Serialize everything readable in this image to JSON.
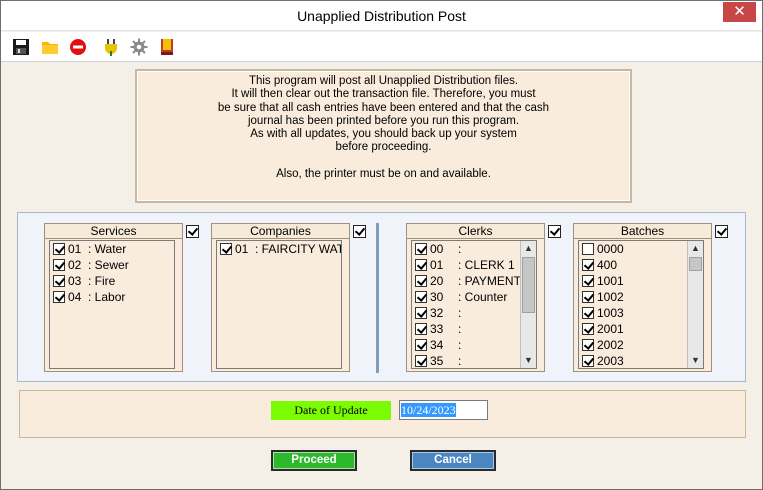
{
  "window": {
    "title": "Unapplied Distribution Post",
    "close_symbol": "✕"
  },
  "toolbar": {
    "icons": [
      "save-icon",
      "open-folder-icon",
      "stop-icon",
      "plug-icon",
      "gear-icon",
      "book-icon"
    ]
  },
  "message": {
    "lines": [
      "This program will post all Unapplied Distribution files.",
      "It will then clear out the transaction file. Therefore, you must",
      "be sure that all cash entries have been entered and that the cash",
      "journal has been printed before you run this program.",
      "As with all updates, you should back up your system",
      "before proceeding.",
      "",
      "Also, the printer must be on and available."
    ]
  },
  "services": {
    "title": "Services",
    "all_checked": true,
    "items": [
      {
        "code": "01",
        "label": "Water",
        "checked": true
      },
      {
        "code": "02",
        "label": "Sewer",
        "checked": true
      },
      {
        "code": "03",
        "label": "Fire",
        "checked": true
      },
      {
        "code": "04",
        "label": "Labor",
        "checked": true
      }
    ]
  },
  "companies": {
    "title": "Companies",
    "all_checked": true,
    "items": [
      {
        "code": "01",
        "label": "FAIRCITY WAT",
        "checked": true
      }
    ]
  },
  "clerks": {
    "title": "Clerks",
    "all_checked": true,
    "items": [
      {
        "code": "00",
        "label": "",
        "checked": true
      },
      {
        "code": "01",
        "label": "CLERK 1",
        "checked": true
      },
      {
        "code": "20",
        "label": "PAYMENT",
        "checked": true
      },
      {
        "code": "30",
        "label": "Counter",
        "checked": true
      },
      {
        "code": "32",
        "label": "",
        "checked": true
      },
      {
        "code": "33",
        "label": "",
        "checked": true
      },
      {
        "code": "34",
        "label": "",
        "checked": true
      },
      {
        "code": "35",
        "label": "",
        "checked": true
      }
    ]
  },
  "batches": {
    "title": "Batches",
    "all_checked": true,
    "items": [
      {
        "code": "0000",
        "checked": false
      },
      {
        "code": "400",
        "checked": true
      },
      {
        "code": "1001",
        "checked": true
      },
      {
        "code": "1002",
        "checked": true
      },
      {
        "code": "1003",
        "checked": true
      },
      {
        "code": "2001",
        "checked": true
      },
      {
        "code": "2002",
        "checked": true
      },
      {
        "code": "2003",
        "checked": true
      }
    ]
  },
  "date_of_update": {
    "label": "Date of Update",
    "value": "10/24/2023"
  },
  "buttons": {
    "proceed": "Proceed",
    "cancel": "Cancel"
  },
  "colors": {
    "proceed": "#2eb82e",
    "cancel": "#4a87c2",
    "date_label": "#7cfc00",
    "close": "#c74646"
  }
}
